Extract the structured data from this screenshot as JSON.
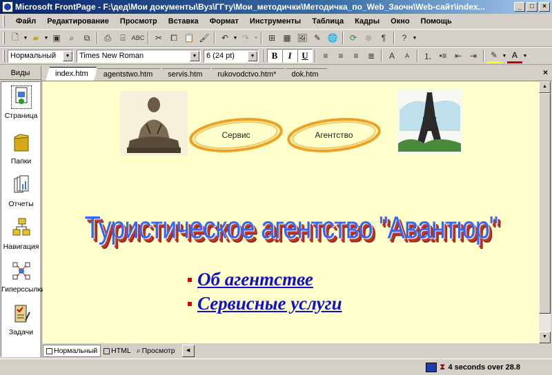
{
  "window": {
    "title": "Microsoft FrontPage - F:\\дед\\Мои документы\\Вуз\\ГГту\\Мои_методички\\Методичка_по_Web_Заочн\\Web-сайт\\index..."
  },
  "menu": [
    "Файл",
    "Редактирование",
    "Просмотр",
    "Вставка",
    "Формат",
    "Инструменты",
    "Таблица",
    "Кадры",
    "Окно",
    "Помощь"
  ],
  "format_toolbar": {
    "style": "Нормальный",
    "font": "Times New Roman",
    "size": "6  (24 pt)",
    "bold": "B",
    "italic": "I",
    "underline": "U"
  },
  "views": {
    "header": "Виды",
    "items": [
      {
        "label": "Страница",
        "icon": "page-view-icon"
      },
      {
        "label": "Папки",
        "icon": "folder-icon"
      },
      {
        "label": "Отчеты",
        "icon": "reports-icon"
      },
      {
        "label": "Навигация",
        "icon": "navigation-icon"
      },
      {
        "label": "Гиперссылки",
        "icon": "hyperlinks-icon"
      },
      {
        "label": "Задачи",
        "icon": "tasks-icon"
      }
    ]
  },
  "tabs": [
    {
      "label": "index.htm",
      "active": true
    },
    {
      "label": "agentstwo.htm",
      "active": false
    },
    {
      "label": "servis.htm",
      "active": false
    },
    {
      "label": "rukovodctvo.htm*",
      "active": false
    },
    {
      "label": "dok.htm",
      "active": false
    }
  ],
  "page": {
    "nav_buttons": [
      "Сервис",
      "Агентство"
    ],
    "headline": "Туристическое агентство \"Авантюр\"",
    "links": [
      "Об агентстве",
      "Сервисные услуги"
    ]
  },
  "bottom_tabs": [
    {
      "label": "Нормальный",
      "active": true
    },
    {
      "label": "HTML",
      "active": false
    },
    {
      "label": "Просмотр",
      "active": false
    }
  ],
  "status": {
    "download_time": "4 seconds over 28.8"
  },
  "colors": {
    "page_background": "#ffffcc",
    "headline_blue": "#3366ff",
    "headline_shadow": "#c0392b",
    "link_blue": "#1010cc",
    "bullet_red": "#d40000",
    "oval_orange": "#f0a020"
  }
}
